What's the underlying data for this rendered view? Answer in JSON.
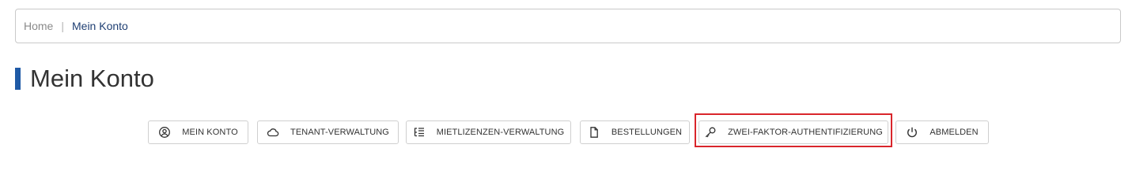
{
  "breadcrumb": {
    "home": "Home",
    "separator": "|",
    "current": "Mein Konto"
  },
  "page": {
    "title": "Mein Konto",
    "accent_color": "#1f5aa6"
  },
  "tabs": [
    {
      "label": "MEIN KONTO",
      "icon": "user-circle-icon"
    },
    {
      "label": "TENANT-VERWALTUNG",
      "icon": "cloud-icon"
    },
    {
      "label": "MIETLIZENZEN-VERWALTUNG",
      "icon": "list-tree-icon"
    },
    {
      "label": "BESTELLUNGEN",
      "icon": "document-icon"
    },
    {
      "label": "ZWEI-FAKTOR-AUTHENTIFIZIERUNG",
      "icon": "key-icon",
      "highlighted": true
    },
    {
      "label": "ABMELDEN",
      "icon": "power-icon"
    }
  ],
  "highlight_color": "#d9252b"
}
